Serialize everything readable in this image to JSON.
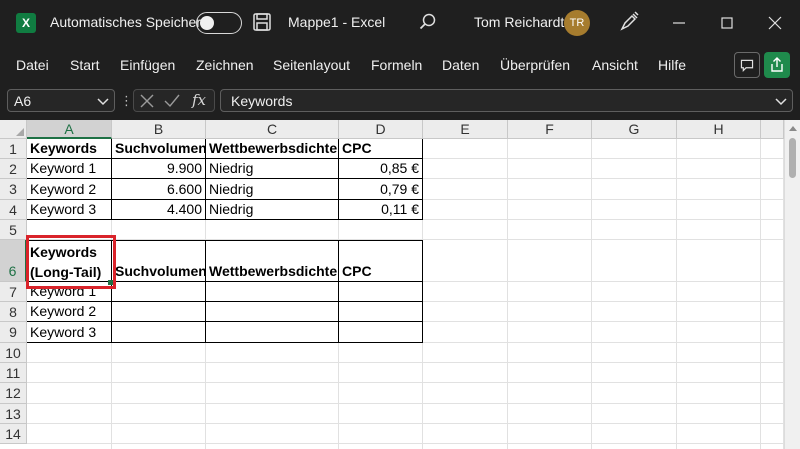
{
  "titlebar": {
    "app_icon_letter": "X",
    "autosave_label": "Automatisches Speichern",
    "document_title": "Mappe1  -  Excel",
    "user_name": "Tom Reichardt",
    "user_initials": "TR"
  },
  "ribbon": {
    "tabs": [
      "Datei",
      "Start",
      "Einfügen",
      "Zeichnen",
      "Seitenlayout",
      "Formeln",
      "Daten",
      "Überprüfen",
      "Ansicht",
      "Hilfe"
    ]
  },
  "formula_bar": {
    "name_box": "A6",
    "fx_label": "fx",
    "formula_value": "Keywords"
  },
  "grid": {
    "columns": [
      "A",
      "B",
      "C",
      "D",
      "E",
      "F",
      "G",
      "H"
    ],
    "rows": [
      "1",
      "2",
      "3",
      "4",
      "5",
      "6",
      "7",
      "8",
      "9",
      "10",
      "11",
      "12",
      "13",
      "14"
    ],
    "cells": {
      "A1": "Keywords",
      "B1": "Suchvolumen",
      "C1": "Wettbewerbsdichte",
      "D1": "CPC",
      "A2": "Keyword 1",
      "B2": "9.900",
      "C2": "Niedrig",
      "D2": "0,85 €",
      "A3": "Keyword 2",
      "B3": "6.600",
      "C3": "Niedrig",
      "D3": "0,79 €",
      "A4": "Keyword 3",
      "B4": "4.400",
      "C4": "Niedrig",
      "D4": "0,11 €",
      "A6_line1": "Keywords",
      "A6_line2": "(Long-Tail)",
      "B6": "Suchvolumen",
      "C6": "Wettbewerbsdichte",
      "D6": "CPC",
      "A7": "Keyword 1",
      "A8": "Keyword 2",
      "A9": "Keyword 3"
    }
  },
  "colors": {
    "excel_green": "#107c41",
    "selection_highlight": "#d9232a",
    "avatar": "#a67c2e"
  },
  "icons": [
    "excel-icon",
    "save-icon",
    "search-icon",
    "pen-icon",
    "minimize-icon",
    "maximize-icon",
    "close-icon",
    "comment-icon",
    "share-icon",
    "cancel-icon",
    "confirm-icon",
    "chevron-down-icon"
  ]
}
